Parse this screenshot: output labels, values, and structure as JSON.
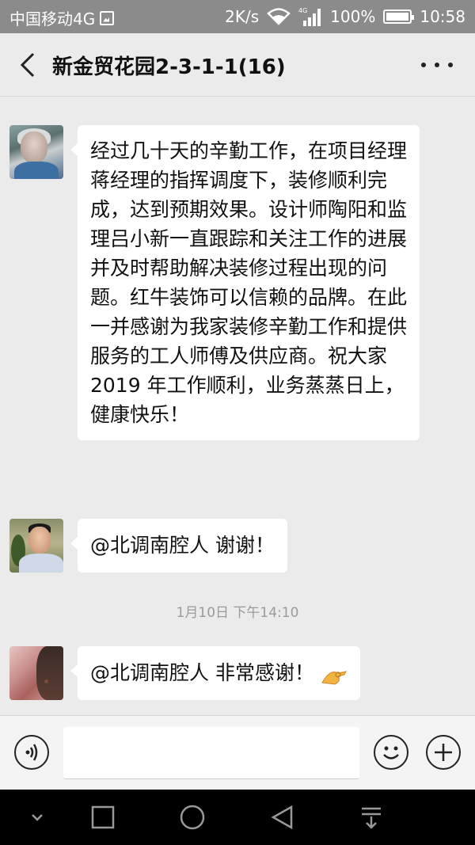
{
  "status_bar": {
    "carrier": "中国移动4G",
    "speed": "2K/s",
    "network_badge": "4G",
    "battery": "100%",
    "time": "10:58"
  },
  "header": {
    "title": "新金贸花园2-3-1-1(16)",
    "icons": {
      "back": "chevron-left-icon",
      "more": "more-dots-icon"
    }
  },
  "messages": [
    {
      "text": "经过几十天的辛勤工作，在项目经理蒋经理的指挥调度下，装修顺利完成，达到预期效果。设计师陶阳和监理吕小新一直跟踪和关注工作的进展并及时帮助解决装修过程出现的问题。红牛装饰可以信赖的品牌。在此一并感谢为我家装修辛勤工作和提供服务的工人师傅及供应商。祝大家2019 年工作顺利，业务蒸蒸日上，健康快乐！"
    },
    {
      "text": "@北调南腔人  谢谢！"
    },
    {
      "text": "@北调南腔人  非常感谢！",
      "emoji": "ok-hand-emoji-icon"
    }
  ],
  "timestamp": "1月10日 下午14:10",
  "input_bar": {
    "placeholder": "",
    "icons": {
      "voice": "voice-icon",
      "emoji": "smiley-icon",
      "plus": "plus-icon"
    }
  },
  "nav_bar": {
    "icons": [
      "chevron-down-icon",
      "square-icon",
      "circle-icon",
      "triangle-back-icon",
      "notification-drawer-icon"
    ]
  },
  "colors": {
    "status_bar_bg": "#8b8b8b",
    "chat_bg": "#ebebeb",
    "bubble_bg": "#ffffff",
    "nav_bar_bg": "#000000"
  }
}
